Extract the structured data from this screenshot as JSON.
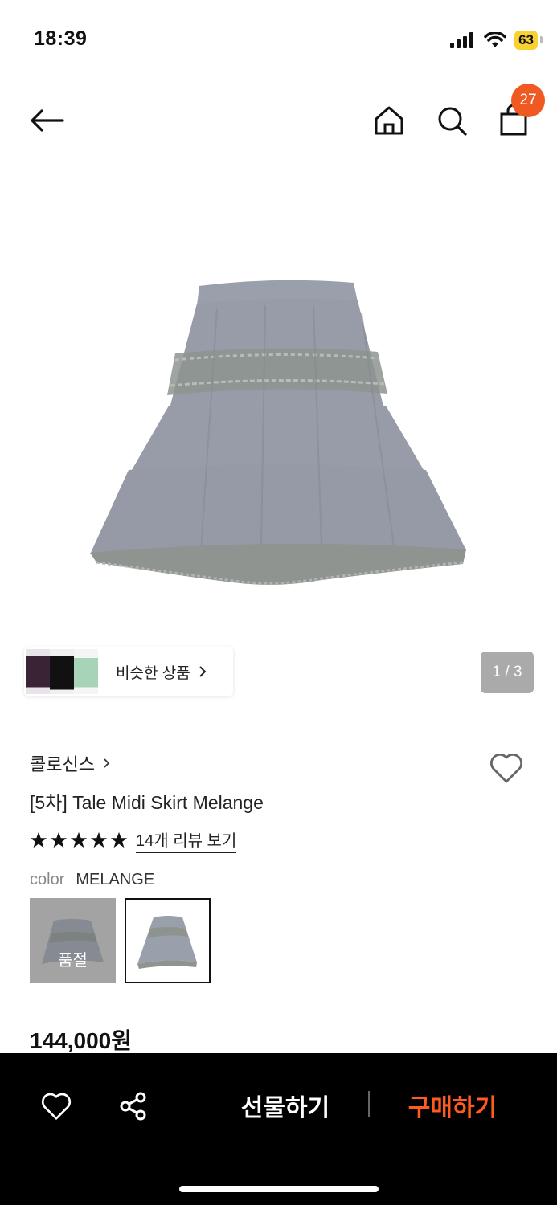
{
  "status_bar": {
    "time": "18:39",
    "battery": "63"
  },
  "header": {
    "cart_count": "27"
  },
  "gallery": {
    "similar_label": "비슷한 상품",
    "pager": "1 / 3"
  },
  "product": {
    "brand": "콜로신스",
    "title": "[5차] Tale Midi Skirt Melange",
    "rating_stars": 5,
    "review_link": "14개 리뷰 보기",
    "color_label": "color",
    "color_value": "MELANGE",
    "options": [
      {
        "status": "품절"
      }
    ],
    "price": "144,000원"
  },
  "bottom_bar": {
    "gift_label": "선물하기",
    "buy_label": "구매하기"
  },
  "colors": {
    "accent": "#f05a22",
    "buy": "#ff5a1f",
    "skirt": "#9aa0ab"
  }
}
